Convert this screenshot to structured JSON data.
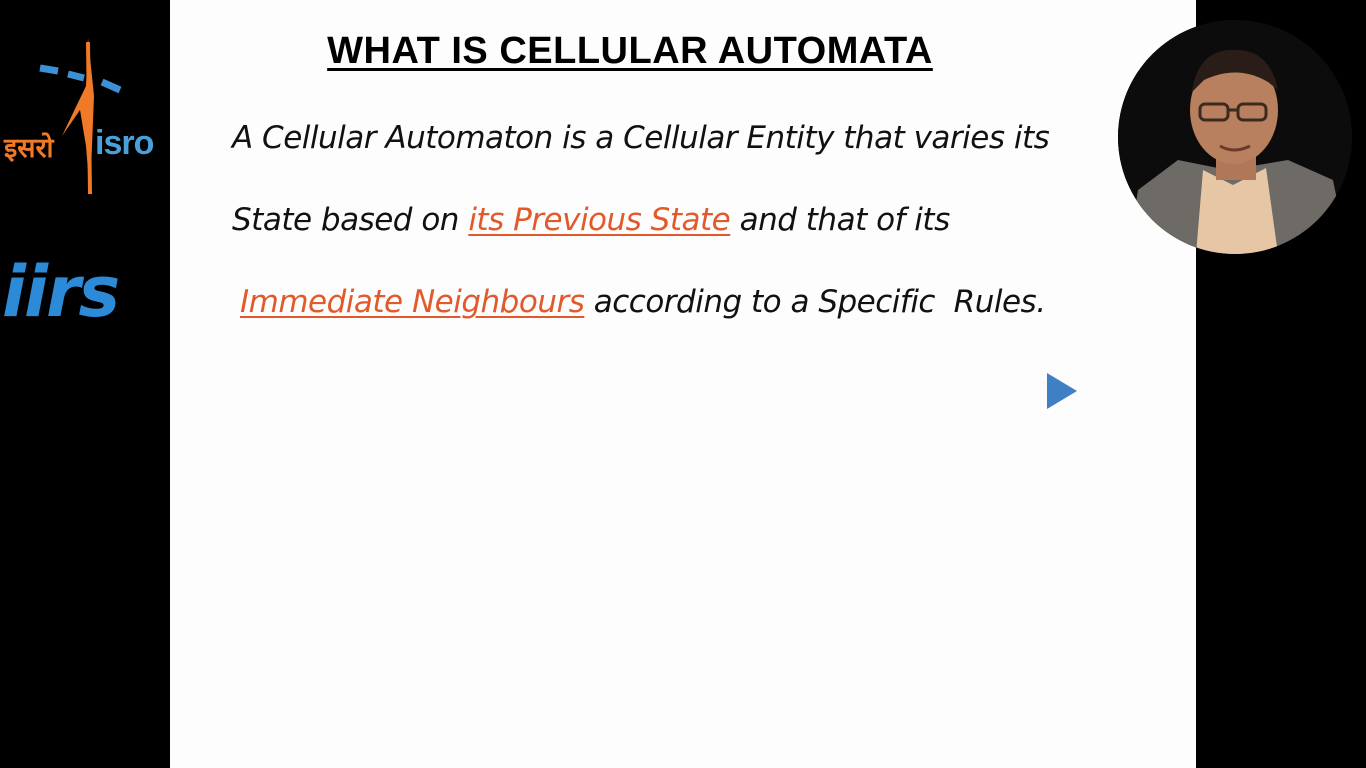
{
  "slide": {
    "title": "WHAT IS CELLULAR AUTOMATA",
    "line1": "A Cellular Automaton is a Cellular Entity that varies its",
    "line2_before": "State based on ",
    "line2_highlight": "its Previous State",
    "line2_after": " and that of its",
    "line3_highlight": "Immediate Neighbours",
    "line3_after": " according to a Specific  Rules."
  },
  "logos": {
    "isro_hindi": "इसरो",
    "isro_latin": "isro",
    "iirs": "iirs"
  },
  "icons": {
    "play": "play-arrow-icon",
    "presenter": "presenter-video"
  },
  "colors": {
    "highlight": "#e25a2b",
    "play_arrow": "#3f7fc4",
    "isro_orange": "#f07a28",
    "isro_blue": "#4aa0dc",
    "iirs_blue": "#2c8ad6"
  }
}
